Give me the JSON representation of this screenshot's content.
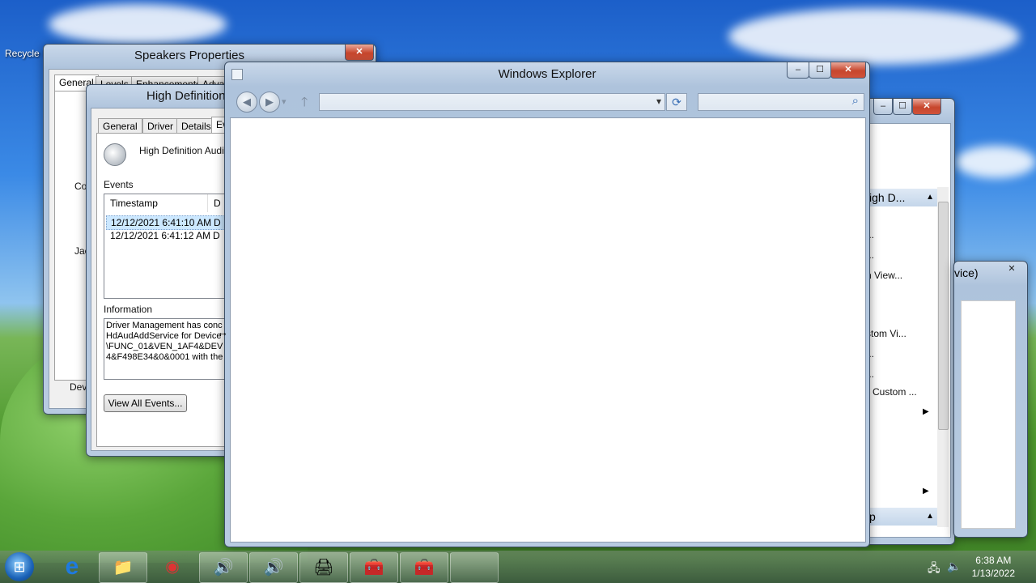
{
  "desktop": {
    "recycle_label": "Recycle I"
  },
  "speakers_window": {
    "title": "Speakers Properties",
    "tabs": [
      "General",
      "Levels",
      "Enhancements",
      "Advan"
    ],
    "side_labels": [
      "Co",
      "Jac",
      "Dev"
    ],
    "close": "✕"
  },
  "hd_window": {
    "title": "High Definition",
    "tabs": [
      "General",
      "Driver",
      "Details",
      "Eve"
    ],
    "device_name": "High Definition Audio",
    "events_label": "Events",
    "columns": [
      "Timestamp",
      "D"
    ],
    "rows": [
      {
        "timestamp": "12/12/2021 6:41:10 AM",
        "d": "D"
      },
      {
        "timestamp": "12/12/2021 6:41:12 AM",
        "d": "D"
      }
    ],
    "information_label": "Information",
    "information_lines": [
      "Driver Management has conc",
      "HdAudAddService for Device",
      "\\FUNC_01&VEN_1AF4&DEV",
      "4&F498E34&0&0001 with the"
    ],
    "view_all_button": "View All Events..."
  },
  "explorer": {
    "title": "Windows Explorer",
    "back_icon": "◀",
    "forward_icon": "▶",
    "up_icon": "🡑",
    "refresh_icon": "⟳",
    "dropdown_icon": "▾",
    "search_icon": "⌕",
    "minimize": "–",
    "maximize": "☐",
    "close": "✕"
  },
  "right_window": {
    "header": "igh D...",
    "items": [
      "...",
      "...",
      "n View...",
      "stom Vi...",
      "...",
      "...",
      "Custom ...",
      "p"
    ],
    "minimize": "–",
    "maximize": "☐",
    "close": "✕"
  },
  "small_window": {
    "title": "vice)",
    "close": "✕"
  },
  "taskbar": {
    "start_icon": "⊞",
    "apps": [
      "e",
      "📁",
      "◉",
      "🔊",
      "🔊",
      "🖨",
      "🧰",
      "🧰",
      ""
    ],
    "time": "6:38 AM",
    "date": "1/13/2022",
    "tray_icons": [
      "🖧",
      "🔈"
    ]
  }
}
